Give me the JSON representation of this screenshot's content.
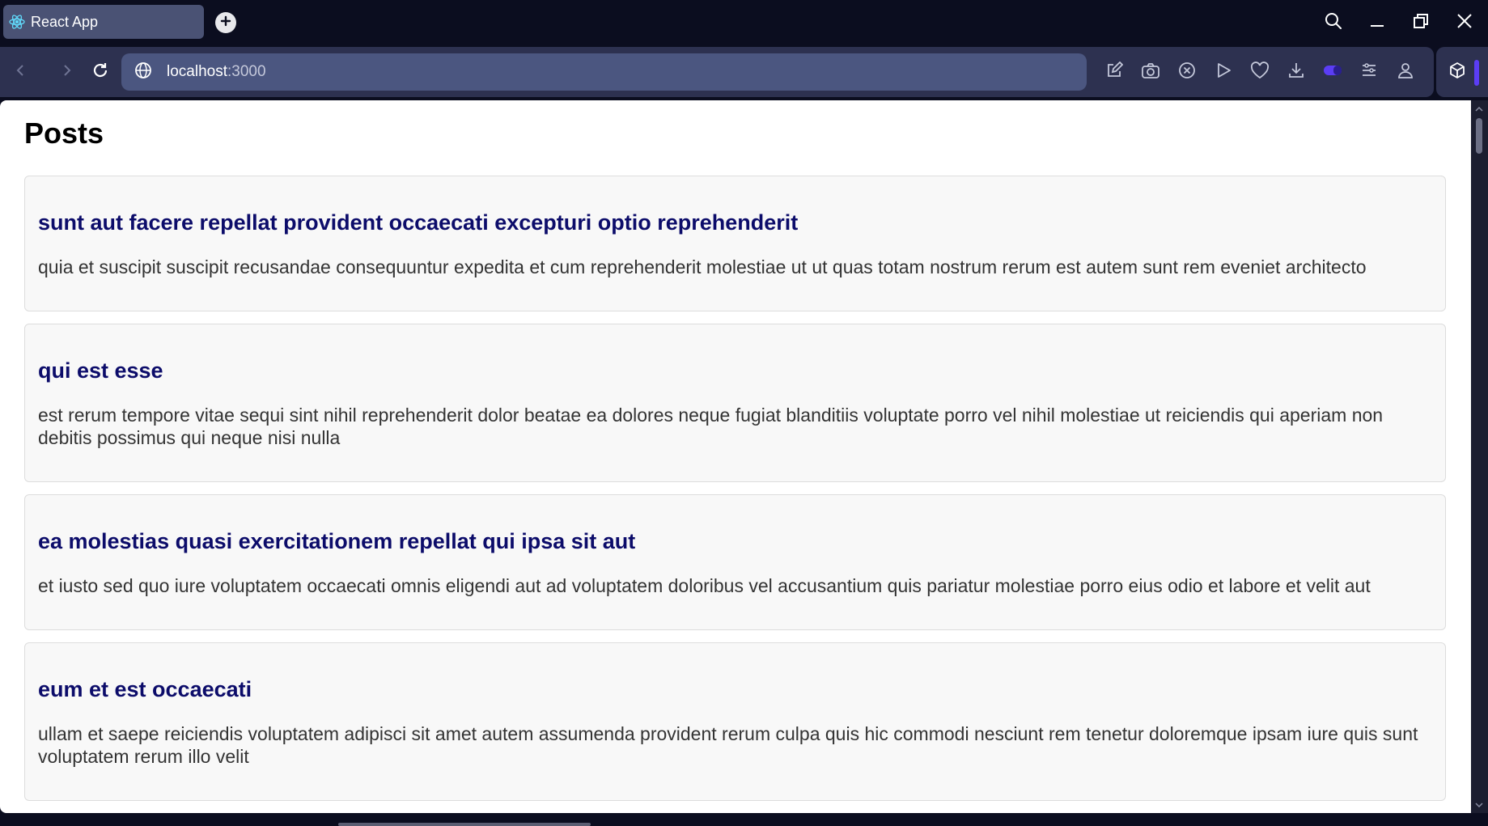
{
  "browser": {
    "tab": {
      "title": "React App",
      "favicon": "react-logo-icon"
    },
    "new_tab_icon": "plus-icon",
    "window_controls": [
      "search-icon",
      "minimize-icon",
      "restore-icon",
      "close-icon"
    ],
    "nav": {
      "back_icon": "chevron-left-icon",
      "forward_icon": "chevron-right-icon",
      "reload_icon": "reload-icon"
    },
    "url": {
      "site_icon": "globe-icon",
      "host": "localhost",
      "port": ":3000"
    },
    "toolbar_icons": [
      "edit-icon",
      "camera-icon",
      "shield-x-icon",
      "play-icon",
      "heart-icon",
      "download-icon",
      "toggle-icon",
      "menu-lines-icon",
      "profile-icon"
    ],
    "extension_icon": "cube-icon",
    "colors": {
      "tab_bg": "#4a5274",
      "nav_bg": "#2d3150",
      "url_bg": "#4b5680",
      "accent": "#5b3df5"
    }
  },
  "page": {
    "title": "Posts",
    "posts": [
      {
        "title": "sunt aut facere repellat provident occaecati excepturi optio reprehenderit",
        "body": "quia et suscipit suscipit recusandae consequuntur expedita et cum reprehenderit molestiae ut ut quas totam nostrum rerum est autem sunt rem eveniet architecto"
      },
      {
        "title": "qui est esse",
        "body": "est rerum tempore vitae sequi sint nihil reprehenderit dolor beatae ea dolores neque fugiat blanditiis voluptate porro vel nihil molestiae ut reiciendis qui aperiam non debitis possimus qui neque nisi nulla"
      },
      {
        "title": "ea molestias quasi exercitationem repellat qui ipsa sit aut",
        "body": "et iusto sed quo iure voluptatem occaecati omnis eligendi aut ad voluptatem doloribus vel accusantium quis pariatur molestiae porro eius odio et labore et velit aut"
      },
      {
        "title": "eum et est occaecati",
        "body": "ullam et saepe reiciendis voluptatem adipisci sit amet autem assumenda provident rerum culpa quis hic commodi nesciunt rem tenetur doloremque ipsam iure quis sunt voluptatem rerum illo velit"
      }
    ],
    "colors": {
      "post_title": "#0c0c6a",
      "post_body": "#333333",
      "card_bg": "#f8f8f8",
      "card_border": "#dddddd"
    }
  }
}
